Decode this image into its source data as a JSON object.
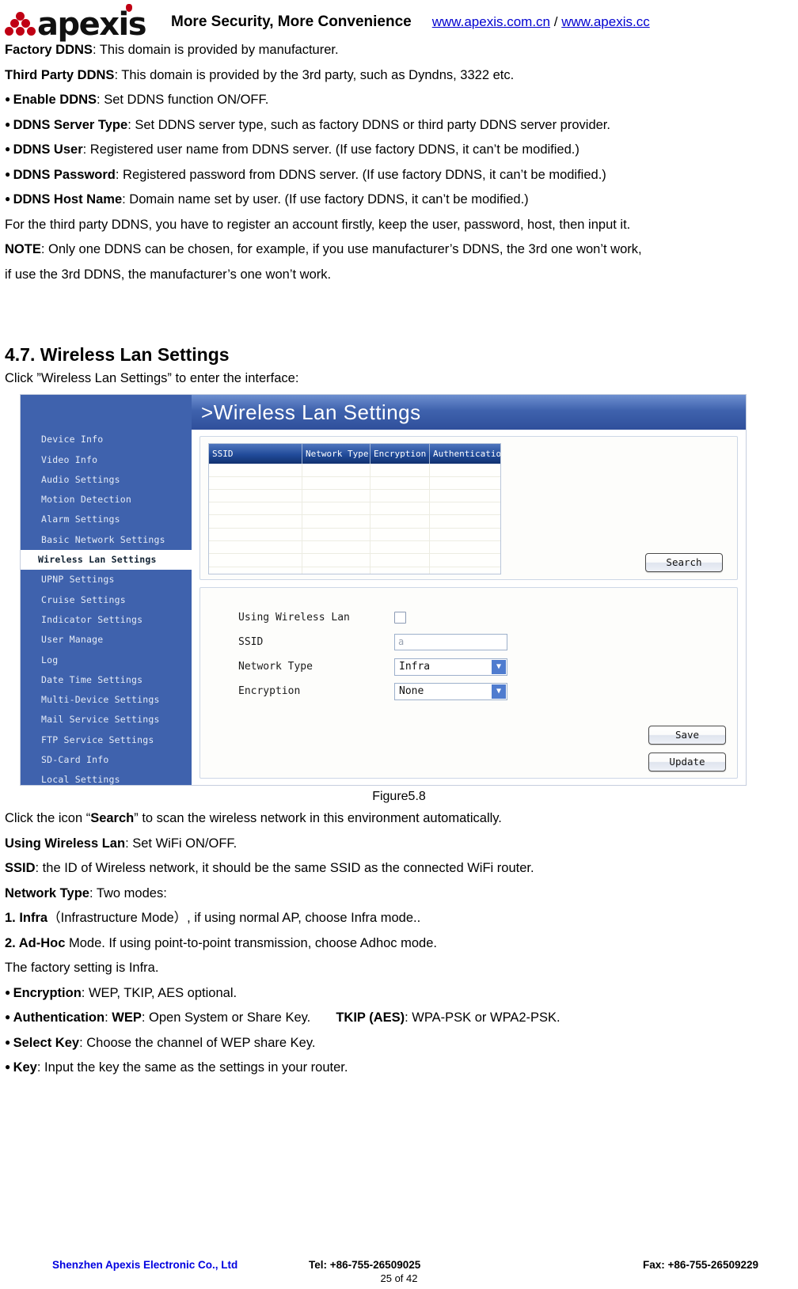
{
  "header": {
    "brand": "apexis",
    "tagline": "More Security, More Convenience",
    "link1": "www.apexis.com.cn",
    "separator": "/",
    "link2": "www.apexis.cc"
  },
  "body_paragraphs": [
    {
      "bold": "Factory DDNS",
      "rest": ": This domain is provided by manufacturer.",
      "bullet": false
    },
    {
      "bold": "Third Party DDNS",
      "rest": ": This domain is provided by the 3rd party, such as Dyndns, 3322 etc.",
      "bullet": false
    },
    {
      "bold": "Enable DDNS",
      "rest": ": Set DDNS function ON/OFF.",
      "bullet": true
    },
    {
      "bold": "DDNS Server Type",
      "rest": ": Set DDNS server type, such as factory DDNS or third party DDNS server provider.",
      "bullet": true
    },
    {
      "bold": "DDNS User",
      "rest": ": Registered user name from DDNS server. (If use factory DDNS, it can’t be modified.)",
      "bullet": true
    },
    {
      "bold": "DDNS Password",
      "rest": ": Registered password from DDNS server. (If use factory DDNS, it can’t be modified.)",
      "bullet": true
    },
    {
      "bold": "DDNS Host Name",
      "rest": ": Domain name set by user. (If use factory DDNS, it can’t be modified.)",
      "bullet": true
    },
    {
      "bold": "",
      "rest": "For the third party DDNS, you have to register an account firstly, keep the user, password, host, then input it.",
      "bullet": false
    },
    {
      "bold": "NOTE",
      "rest": ": Only one DDNS can be chosen, for example, if you use manufacturer’s DDNS, the 3rd one won’t work,",
      "bullet": false
    },
    {
      "bold": "",
      "rest": "if use the 3rd DDNS, the manufacturer’s one won’t work.",
      "bullet": false
    }
  ],
  "section": {
    "heading": "4.7. Wireless Lan Settings",
    "intro": "Click ”Wireless Lan Settings” to enter the interface:"
  },
  "figure": {
    "caption": "Figure5.8",
    "panel_title": ">Wireless Lan Settings",
    "sidebar_items": [
      "Device Info",
      "Video Info",
      "Audio Settings",
      "Motion Detection",
      "Alarm Settings",
      "Basic Network Settings",
      "Wireless Lan Settings",
      "UPNP Settings",
      "Cruise Settings",
      "Indicator Settings",
      "User Manage",
      "Log",
      "Date Time Settings",
      "Multi-Device Settings",
      "Mail Service Settings",
      "FTP Service Settings",
      "SD-Card Info",
      "Local Settings"
    ],
    "active_item": "Wireless Lan Settings",
    "table": {
      "columns": [
        "SSID",
        "Network Type",
        "Encryption",
        "Authentication"
      ],
      "rows": []
    },
    "search_button": "Search",
    "form": {
      "using_wireless_lan_label": "Using Wireless Lan",
      "using_wireless_lan_checked": false,
      "ssid_label": "SSID",
      "ssid_value": "a",
      "network_type_label": "Network Type",
      "network_type_value": "Infra",
      "encryption_label": "Encryption",
      "encryption_value": "None"
    },
    "save_button": "Save",
    "update_button": "Update",
    "colors": {
      "sidebar_bg": "#3f62ad",
      "title_bar": "#2f4f9b",
      "table_header": "#12316f",
      "dropdown_arrow": "#4f7ccf"
    }
  },
  "body_paragraphs2": [
    {
      "bold": "",
      "rest": "Click the icon “Search” to scan the wireless network in this environment automatically.",
      "bullet": false,
      "inline_bold": "Search"
    },
    {
      "bold": "Using Wireless Lan",
      "rest": ": Set WiFi ON/OFF.",
      "bullet": false
    },
    {
      "bold": "SSID",
      "rest": ": the ID of Wireless network, it should be the same SSID as the connected WiFi router.",
      "bullet": false
    },
    {
      "bold": "Network Type",
      "rest": ": Two modes:",
      "bullet": false
    },
    {
      "bold": "1. Infra",
      "rest": "（Infrastructure Mode）, if using normal AP, choose Infra mode..",
      "bullet": false
    },
    {
      "bold": "2. Ad-Hoc",
      "rest": " Mode. If using point-to-point transmission, choose Adhoc mode.",
      "bullet": false
    },
    {
      "bold": "",
      "rest": "The factory setting is Infra.",
      "bullet": false
    },
    {
      "bold": "Encryption",
      "rest": ": WEP, TKIP, AES optional.",
      "bullet": true
    },
    {
      "bold": "Authentication",
      "rest": "",
      "bullet": true,
      "special": "auth"
    },
    {
      "bold": "Select Key",
      "rest": ": Choose the channel of WEP share Key.",
      "bullet": true
    },
    {
      "bold": "Key",
      "rest": ": Input the key the same as the settings in your router.",
      "bullet": true
    }
  ],
  "auth_line": {
    "lead": "Authentication",
    "mid1": ": ",
    "b1": "WEP",
    "mid2": ": Open System or Share Key.",
    "b2": "TKIP (AES)",
    "mid3": ": WPA-PSK or WPA2-PSK."
  },
  "footer": {
    "company": "Shenzhen Apexis Electronic Co., Ltd",
    "tel": "Tel: +86-755-26509025",
    "fax": "Fax: +86-755-26509229",
    "page": "25 of 42"
  }
}
